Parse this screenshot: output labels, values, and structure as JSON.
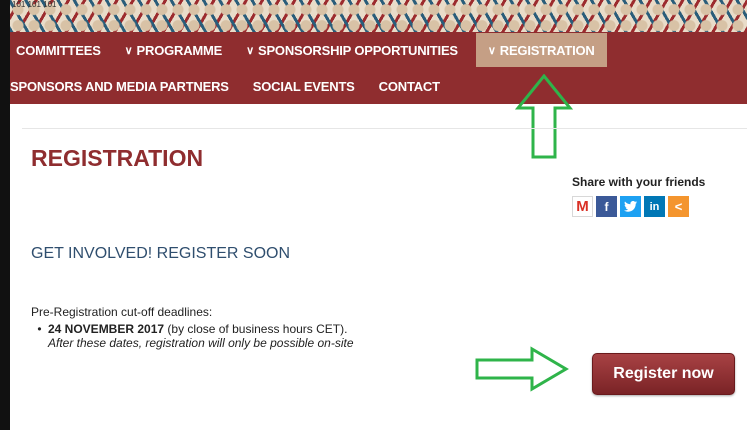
{
  "corner_label": "101 101 101",
  "nav": {
    "row1": [
      {
        "label": "COMMITTEES",
        "chevron": false,
        "active": false
      },
      {
        "label": "PROGRAMME",
        "chevron": true,
        "active": false
      },
      {
        "label": "SPONSORSHIP OPPORTUNITIES",
        "chevron": true,
        "active": false
      },
      {
        "label": "REGISTRATION",
        "chevron": true,
        "active": true
      }
    ],
    "row2": [
      {
        "label": "SPONSORS AND MEDIA PARTNERS"
      },
      {
        "label": "SOCIAL EVENTS"
      },
      {
        "label": "CONTACT"
      }
    ]
  },
  "page": {
    "title": "REGISTRATION",
    "share_label": "Share with your friends",
    "share_icons": [
      "gmail-icon",
      "facebook-icon",
      "twitter-icon",
      "linkedin-icon",
      "share-icon"
    ],
    "sub_heading": "GET INVOLVED! REGISTER SOON",
    "cutoff_label": "Pre-Registration cut-off deadlines:",
    "deadline_date": "24 NOVEMBER 2017",
    "deadline_suffix": " (by close of business hours CET).",
    "deadline_note": "After these dates, registration will only be possible on-site",
    "register_button": "Register now"
  },
  "colors": {
    "nav_bg": "#8f2d2f",
    "nav_active": "#c59f85",
    "title": "#8f2d2f",
    "sub_heading": "#2f4e6e",
    "annotation_arrow": "#2fb44a"
  }
}
